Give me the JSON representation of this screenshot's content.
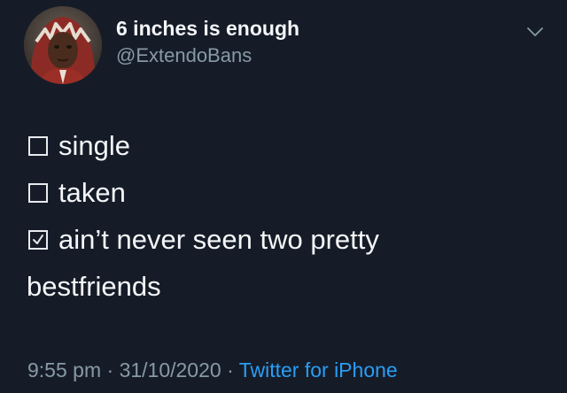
{
  "author": {
    "display_name": "6 inches is enough",
    "handle": "@ExtendoBans"
  },
  "tweet": {
    "lines": [
      {
        "checked": false,
        "text": "single"
      },
      {
        "checked": false,
        "text": "taken"
      },
      {
        "checked": true,
        "text": "ain’t never seen two pretty"
      }
    ],
    "continuation": "bestfriends"
  },
  "meta": {
    "time": "9:55 pm",
    "separator": " · ",
    "date": "31/10/2020",
    "source": "Twitter for iPhone"
  },
  "icons": {
    "menu": "chevron-down-icon",
    "avatar": "profile-photo"
  },
  "colors": {
    "background": "#151c28",
    "text": "#f4f6f8",
    "secondary": "#8899a6",
    "link": "#2a9df4"
  }
}
